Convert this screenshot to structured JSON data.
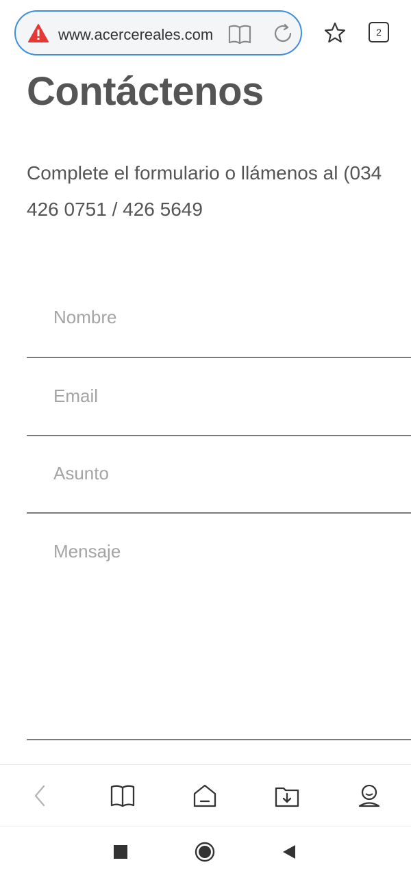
{
  "browser": {
    "url": "www.acercereales.com",
    "tab_count": "2",
    "url_warning_icon": "warning-triangle-icon",
    "reader_icon": "reader-mode-icon",
    "reload_icon": "reload-icon",
    "star_icon": "star-icon",
    "accent_color": "#3d8ee0",
    "warning_color": "#e53935"
  },
  "page": {
    "title": "Contáctenos",
    "intro_line1": "Complete el formulario o llámenos al (034",
    "intro_line2": "426 0751 / 426 5649"
  },
  "form": {
    "nombre_placeholder": "Nombre",
    "email_placeholder": "Email",
    "asunto_placeholder": "Asunto",
    "mensaje_placeholder": "Mensaje"
  },
  "bottom_toolbar": {
    "items": [
      "back-icon",
      "bookmarks-icon",
      "home-icon",
      "downloads-icon",
      "profile-icon"
    ]
  },
  "system_nav": {
    "items": [
      "recents-square-icon",
      "home-circle-icon",
      "back-triangle-icon"
    ]
  }
}
